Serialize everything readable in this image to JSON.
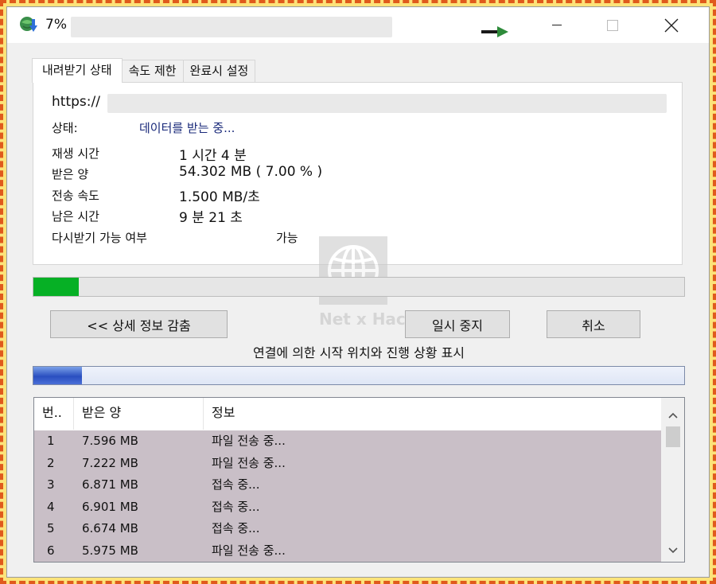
{
  "window": {
    "title": "7%",
    "colors": {
      "progress_fill": "#06b025",
      "connection_fill": "#2a4fc0",
      "list_row_bg": "#c9bfc7"
    }
  },
  "tabs": [
    {
      "label": "내려받기 상태",
      "active": true
    },
    {
      "label": "속도 제한",
      "active": false
    },
    {
      "label": "완료시 설정",
      "active": false
    }
  ],
  "status": {
    "url_prefix": "https://",
    "status_label": "상태:",
    "status_value": "데이터를 받는 중...",
    "rows": [
      {
        "label": "재생 시간",
        "value": "1 시간 4 분"
      },
      {
        "label": "받은 양",
        "value": "54.302  MB  ( 7.00 % )"
      },
      {
        "label": "전송 속도",
        "value": "1.500  MB/초"
      },
      {
        "label": "남은 시간",
        "value": "9 분 21 초"
      }
    ],
    "resume_label": "다시받기 가능 여부",
    "resume_value": "가능"
  },
  "progress": {
    "percent": 7.0
  },
  "buttons": {
    "details": "<< 상세 정보 감춤",
    "pause": "일시 중지",
    "cancel": "취소"
  },
  "connection": {
    "caption": "연결에 의한 시작 위치와 진행 상황 표시",
    "fraction": 0.075
  },
  "list": {
    "headers": [
      "번..",
      "받은 양",
      "정보"
    ],
    "rows": [
      {
        "n": "1",
        "size": "7.596  MB",
        "info": "파일 전송 중..."
      },
      {
        "n": "2",
        "size": "7.222  MB",
        "info": "파일 전송 중..."
      },
      {
        "n": "3",
        "size": "6.871  MB",
        "info": "접속 중..."
      },
      {
        "n": "4",
        "size": "6.901  MB",
        "info": "접속 중..."
      },
      {
        "n": "5",
        "size": "6.674  MB",
        "info": "접속 중..."
      },
      {
        "n": "6",
        "size": "5.975  MB",
        "info": "파일 전송 중..."
      }
    ]
  },
  "watermark": {
    "text": "Net x Hack"
  },
  "icons": {
    "app": "globe-download-icon",
    "minimize": "minimize-icon",
    "maximize": "maximize-icon",
    "close": "close-icon",
    "scroll_up": "chevron-up-icon",
    "scroll_down": "chevron-down-icon"
  }
}
